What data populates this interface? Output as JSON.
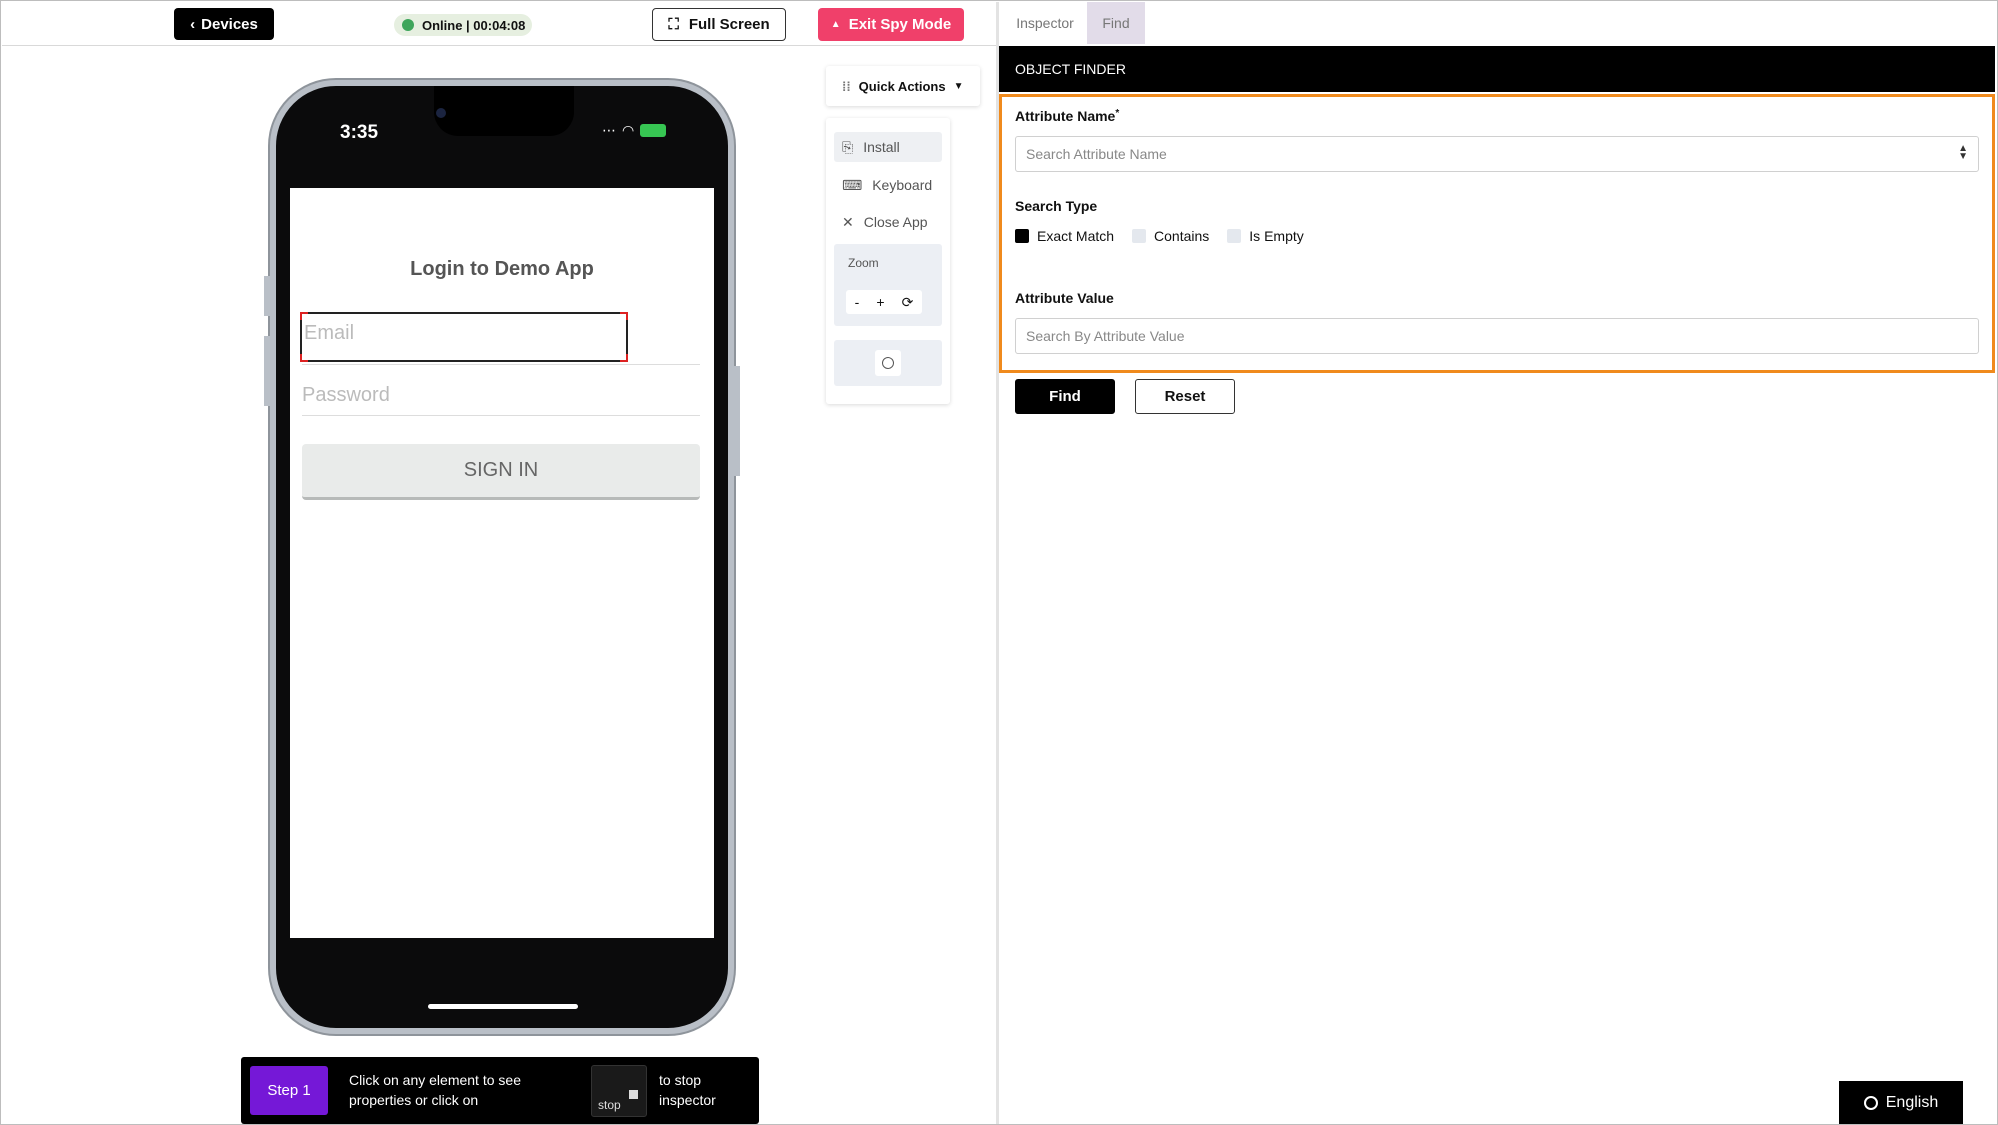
{
  "toolbar": {
    "devices_label": "Devices",
    "status_label": "Online | 00:04:08",
    "fullscreen_label": "Full Screen",
    "exit_label": "Exit Spy Mode"
  },
  "device": {
    "time": "3:35",
    "app_title": "Login to Demo App",
    "email_placeholder": "Email",
    "password_placeholder": "Password",
    "signin_label": "SIGN IN"
  },
  "quick_actions": {
    "label": "Quick Actions",
    "items": [
      {
        "label": "Install",
        "icon": "install-icon"
      },
      {
        "label": "Keyboard",
        "icon": "keyboard-icon"
      },
      {
        "label": "Close App",
        "icon": "close-icon"
      }
    ],
    "zoom_label": "Zoom",
    "zoom_minus": "-",
    "zoom_plus": "+"
  },
  "stepbar": {
    "step_label": "Step 1",
    "instruction": "Click on any element to see properties or click on",
    "stop_label": "stop",
    "suffix": "to stop inspector"
  },
  "tabs": [
    {
      "label": "Inspector",
      "active": false
    },
    {
      "label": "Find",
      "active": true
    }
  ],
  "finder": {
    "header": "OBJECT FINDER",
    "attr_name_label": "Attribute Name",
    "attr_name_required": "*",
    "attr_name_placeholder": "Search Attribute Name",
    "search_type_label": "Search Type",
    "options": [
      {
        "label": "Exact Match",
        "checked": true
      },
      {
        "label": "Contains",
        "checked": false
      },
      {
        "label": "Is Empty",
        "checked": false
      }
    ],
    "attr_value_label": "Attribute Value",
    "attr_value_placeholder": "Search By Attribute Value",
    "find_label": "Find",
    "reset_label": "Reset"
  },
  "language": "English",
  "colors": {
    "accent": "#f08a1c",
    "danger": "#f0406a",
    "step": "#7518d7",
    "online": "#3ea55b"
  }
}
